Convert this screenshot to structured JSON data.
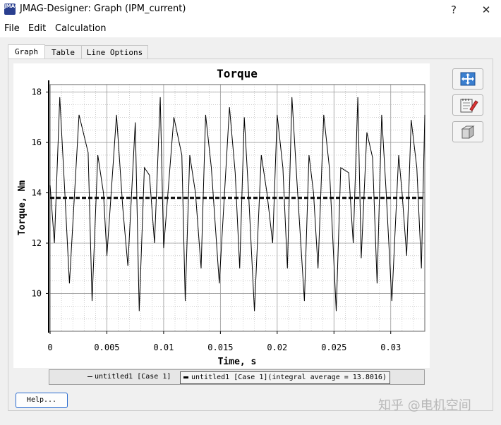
{
  "window": {
    "title": "JMAG-Designer: Graph (IPM_current)",
    "help_glyph": "?",
    "close_glyph": "✕",
    "icon_text": "JMAG"
  },
  "menu": {
    "file": "File",
    "edit": "Edit",
    "calculation": "Calculation"
  },
  "tabs": [
    {
      "label": "Graph",
      "active": true
    },
    {
      "label": "Table",
      "active": false
    },
    {
      "label": "Line Options",
      "active": false
    }
  ],
  "side_buttons": [
    {
      "icon": "fit-view-icon"
    },
    {
      "icon": "edit-notes-icon"
    },
    {
      "icon": "copy-icon"
    }
  ],
  "legend": {
    "entry1": "untitled1 [Case 1]",
    "entry2": "untitled1 [Case 1](integral average = 13.8016)"
  },
  "help_button": "Help...",
  "watermark": "知乎 @电机空间",
  "chart_data": {
    "type": "line",
    "title": "Torque",
    "xlabel": "Time, s",
    "ylabel": "Torque, Nm",
    "xlim": [
      0,
      0.033
    ],
    "ylim": [
      8.5,
      18.3
    ],
    "xticks": [
      "0",
      "0.005",
      "0.01",
      "0.015",
      "0.02",
      "0.025",
      "0.03"
    ],
    "yticks": [
      "10",
      "12",
      "14",
      "16",
      "18"
    ],
    "grid": true,
    "series": [
      {
        "name": "untitled1 [Case 1]",
        "style": "solid",
        "color": "#000000",
        "x": [
          0,
          0.00038,
          0.00085,
          0.0013,
          0.0017,
          0.00255,
          0.00335,
          0.0037,
          0.0042,
          0.0047,
          0.005,
          0.00585,
          0.0064,
          0.00685,
          0.0075,
          0.00785,
          0.0083,
          0.00875,
          0.0092,
          0.0097,
          0.01,
          0.0109,
          0.0116,
          0.0119,
          0.0123,
          0.0128,
          0.0133,
          0.0137,
          0.0142,
          0.0149,
          0.0158,
          0.0163,
          0.0167,
          0.0171,
          0.0175,
          0.018,
          0.0186,
          0.0191,
          0.0196,
          0.02,
          0.0205,
          0.0209,
          0.0213,
          0.0218,
          0.0224,
          0.0228,
          0.0232,
          0.0236,
          0.0241,
          0.0246,
          0.0252,
          0.0256,
          0.0263,
          0.0267,
          0.0271,
          0.0274,
          0.0279,
          0.0284,
          0.0288,
          0.0292,
          0.0296,
          0.0301,
          0.0307,
          0.031,
          0.0314,
          0.0318,
          0.0323,
          0.0327,
          0.033
        ],
        "y": [
          14.3,
          12.0,
          17.8,
          14.0,
          10.4,
          17.1,
          15.6,
          9.7,
          15.5,
          14.0,
          11.5,
          17.1,
          13.4,
          11.1,
          16.8,
          9.3,
          15.0,
          14.7,
          12.0,
          17.8,
          11.8,
          17.0,
          15.5,
          9.7,
          15.5,
          14.0,
          11.0,
          17.1,
          15.0,
          10.4,
          17.4,
          14.8,
          11.0,
          17.0,
          13.8,
          9.3,
          15.5,
          14.0,
          12.0,
          17.1,
          15.0,
          11.0,
          17.8,
          14.0,
          9.7,
          15.5,
          14.0,
          11.0,
          17.1,
          15.0,
          9.3,
          15.0,
          14.8,
          12.0,
          17.8,
          11.4,
          16.4,
          15.4,
          10.4,
          17.1,
          14.0,
          9.7,
          15.5,
          14.0,
          11.5,
          16.9,
          15.0,
          11.0,
          17.1
        ]
      },
      {
        "name": "untitled1 [Case 1](integral average = 13.8016)",
        "style": "dashed",
        "color": "#000000",
        "x": [
          0,
          0.033
        ],
        "y": [
          13.8016,
          13.8016
        ]
      }
    ]
  }
}
